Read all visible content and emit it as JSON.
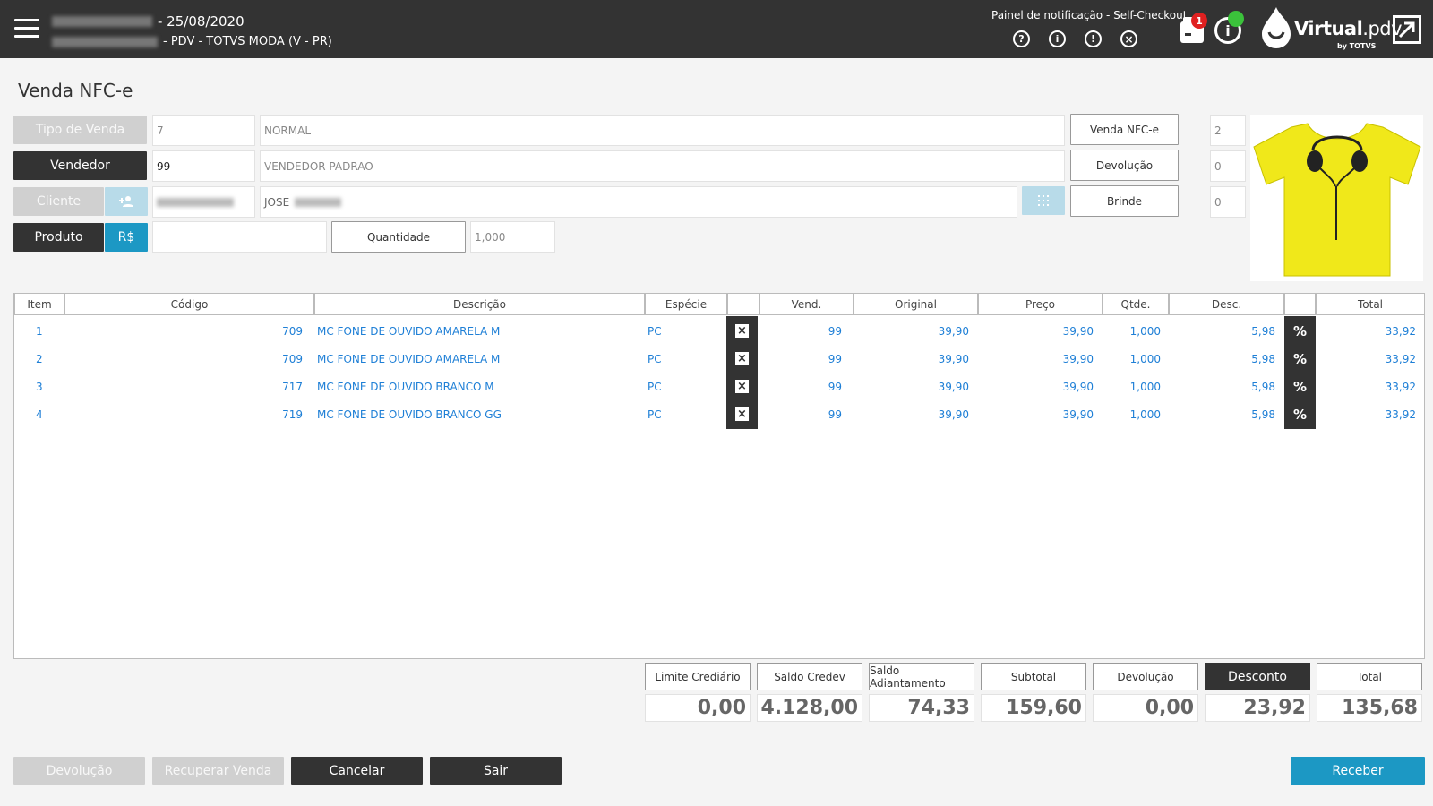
{
  "header": {
    "date": "- 25/08/2020",
    "store": "- PDV - TOTVS MODA (V - PR)",
    "notification_title": "Painel de notificação - Self-Checkout",
    "badge_count": "1",
    "logo_text_bold": "Virtual",
    "logo_text_light": ".pdv",
    "logo_sub": "by TOTVS"
  },
  "page": {
    "title": "Venda NFC-e"
  },
  "form": {
    "tipo_venda_label": "Tipo de Venda",
    "tipo_venda_code": "7",
    "tipo_venda_desc": "NORMAL",
    "vendedor_label": "Vendedor",
    "vendedor_code": "99",
    "vendedor_desc": "VENDEDOR PADRAO",
    "cliente_label": "Cliente",
    "cliente_name": "JOSE",
    "produto_label": "Produto",
    "rs_label": "R$",
    "quantidade_label": "Quantidade",
    "quantidade_value": "1,000",
    "venda_nfce_label": "Venda NFC-e",
    "venda_nfce_value": "2",
    "devolucao_label": "Devolução",
    "devolucao_value": "0",
    "brinde_label": "Brinde",
    "brinde_value": "0"
  },
  "table": {
    "headers": [
      "Item",
      "Código",
      "Descrição",
      "Espécie",
      "",
      "Vend.",
      "Original",
      "Preço",
      "Qtde.",
      "Desc.",
      "",
      "Total"
    ],
    "rows": [
      {
        "item": "1",
        "codigo": "709",
        "descricao": "MC FONE DE OUVIDO AMARELA M",
        "especie": "PC",
        "vend": "99",
        "original": "39,90",
        "preco": "39,90",
        "qtde": "1,000",
        "desc": "5,98",
        "total": "33,92"
      },
      {
        "item": "2",
        "codigo": "709",
        "descricao": "MC FONE DE OUVIDO AMARELA M",
        "especie": "PC",
        "vend": "99",
        "original": "39,90",
        "preco": "39,90",
        "qtde": "1,000",
        "desc": "5,98",
        "total": "33,92"
      },
      {
        "item": "3",
        "codigo": "717",
        "descricao": "MC FONE DE OUVIDO BRANCO M",
        "especie": "PC",
        "vend": "99",
        "original": "39,90",
        "preco": "39,90",
        "qtde": "1,000",
        "desc": "5,98",
        "total": "33,92"
      },
      {
        "item": "4",
        "codigo": "719",
        "descricao": "MC FONE DE OUVIDO BRANCO GG",
        "especie": "PC",
        "vend": "99",
        "original": "39,90",
        "preco": "39,90",
        "qtde": "1,000",
        "desc": "5,98",
        "total": "33,92"
      }
    ]
  },
  "totals": [
    {
      "label": "Limite Crediário",
      "value": "0,00"
    },
    {
      "label": "Saldo Credev",
      "value": "4.128,00"
    },
    {
      "label": "Saldo Adiantamento",
      "value": "74,33"
    },
    {
      "label": "Subtotal",
      "value": "159,60"
    },
    {
      "label": "Devolução",
      "value": "0,00"
    },
    {
      "label": "Desconto",
      "value": "23,92"
    },
    {
      "label": "Total",
      "value": "135,68"
    }
  ],
  "footer": {
    "devolucao": "Devolução",
    "recuperar": "Recuperar Venda",
    "cancelar": "Cancelar",
    "sair": "Sair",
    "receber": "Receber"
  },
  "colors": {
    "header_bg": "#333333",
    "accent_blue": "#1c98c4",
    "link_blue": "#1e7fd6",
    "badge_red": "#e02020",
    "status_green": "#3bc23b"
  }
}
